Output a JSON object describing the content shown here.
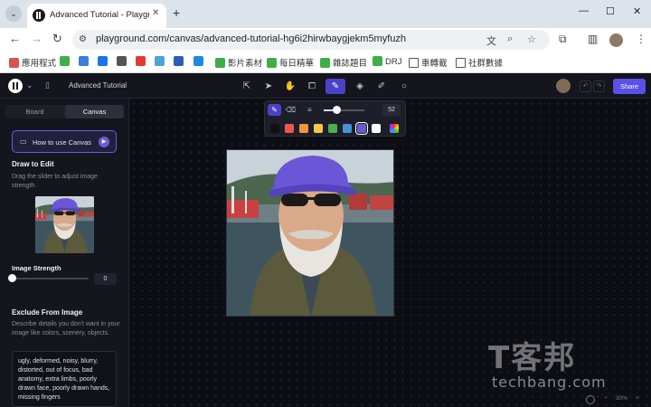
{
  "browser": {
    "tab_title": "Advanced Tutorial - Playgroun",
    "tab_close": "✕",
    "new_tab": "+",
    "url": "playground.com/canvas/advanced-tutorial-hg6i2hirwbaygjekm5myfuzh",
    "window_controls": [
      "—",
      "☐",
      "✕"
    ]
  },
  "bookmarks": [
    {
      "label": "應用程式",
      "color": "#d9534f"
    },
    {
      "label": "",
      "color": "#3fae49"
    },
    {
      "label": "",
      "color": "#3b7ddd"
    },
    {
      "label": "",
      "color": "#1a73e8"
    },
    {
      "label": "",
      "color": "#555555"
    },
    {
      "label": "",
      "color": "#e53935"
    },
    {
      "label": "",
      "color": "#4fa3d1"
    },
    {
      "label": "",
      "color": "#2b5fb3"
    },
    {
      "label": "",
      "color": "#1e88e5"
    },
    {
      "label": "影片素材",
      "color": "#3fae49"
    },
    {
      "label": "每日精華",
      "color": "#3fae49"
    },
    {
      "label": "雜誌題目",
      "color": "#3fae49"
    },
    {
      "label": "DRJ",
      "color": "#3fae49"
    },
    {
      "label": "車轉載",
      "color": "#ffffff"
    },
    {
      "label": "社群數據",
      "color": "#ffffff"
    }
  ],
  "app": {
    "project_title": "Advanced Tutorial",
    "share_label": "Share",
    "tools": [
      "export-icon",
      "select-icon",
      "hand-icon",
      "edit-image-icon",
      "brush-icon",
      "fill-icon",
      "pen-icon",
      "comment-icon"
    ]
  },
  "sidebar": {
    "tabs": [
      {
        "label": "Board",
        "active": false
      },
      {
        "label": "Canvas",
        "active": true
      }
    ],
    "how_to_label": "How to use Canvas",
    "draw_title": "Draw to Edit",
    "draw_desc": "Drag the slider to adjust image strength.",
    "strength_label": "Image Strength",
    "strength_value": "0",
    "exclude_title": "Exclude From Image",
    "exclude_desc": "Describe details you don't want in your image like colors, scenery, objects.",
    "exclude_text": "ugly, deformed, noisy, blurry, distorted, out of focus, bad anatomy, extra limbs, poorly drawn face, poorly drawn hands, missing fingers"
  },
  "brush_popover": {
    "size_value": "52",
    "size_fraction": 0.3,
    "colors": [
      "#111111",
      "#e85a4f",
      "#f0963c",
      "#f3c74b",
      "#4caf50",
      "#4a90d9",
      "#6a5acd",
      "#ffffff"
    ],
    "selected_color": "#6a5acd"
  },
  "zoom": {
    "minus": "−",
    "value": "30%",
    "plus": "+"
  },
  "watermark": {
    "cn": "T客邦",
    "en": "techbang.com"
  }
}
